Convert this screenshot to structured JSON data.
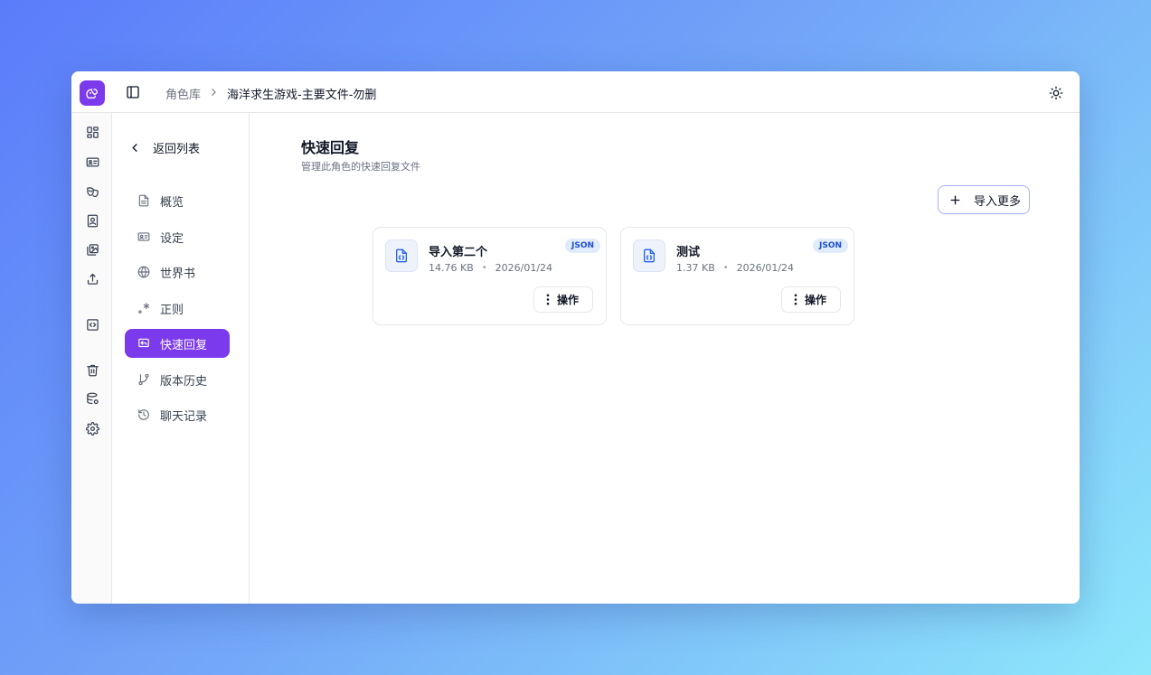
{
  "breadcrumb": {
    "root": "角色库",
    "current": "海洋求生游戏-主要文件-勿删"
  },
  "rail": {
    "items": [
      "dashboard-icon",
      "id-card-icon",
      "masks-icon",
      "contact-book-icon",
      "images-icon",
      "upload-icon",
      "code-file-icon",
      "trash-icon",
      "database-settings-icon",
      "gear-icon"
    ]
  },
  "subnav": {
    "back_label": "返回列表",
    "items": [
      {
        "label": "概览",
        "icon": "document-icon"
      },
      {
        "label": "设定",
        "icon": "id-card-icon"
      },
      {
        "label": "世界书",
        "icon": "globe-icon"
      },
      {
        "label": "正则",
        "icon": "regex-icon"
      },
      {
        "label": "快速回复",
        "icon": "message-reply-icon",
        "active": true
      },
      {
        "label": "版本历史",
        "icon": "git-branch-icon"
      },
      {
        "label": "聊天记录",
        "icon": "history-icon"
      }
    ]
  },
  "main": {
    "title": "快速回复",
    "subtitle": "管理此角色的快速回复文件",
    "import_label": "导入更多",
    "files": [
      {
        "name": "导入第二个",
        "size": "14.76 KB",
        "date": "2026/01/24",
        "type": "JSON",
        "action": "操作"
      },
      {
        "name": "测试",
        "size": "1.37 KB",
        "date": "2026/01/24",
        "type": "JSON",
        "action": "操作"
      }
    ]
  },
  "colors": {
    "accent": "#7c3aed",
    "badge_bg": "#e0ebfb",
    "badge_text": "#1d4ed8",
    "border": "#e5e7eb"
  }
}
